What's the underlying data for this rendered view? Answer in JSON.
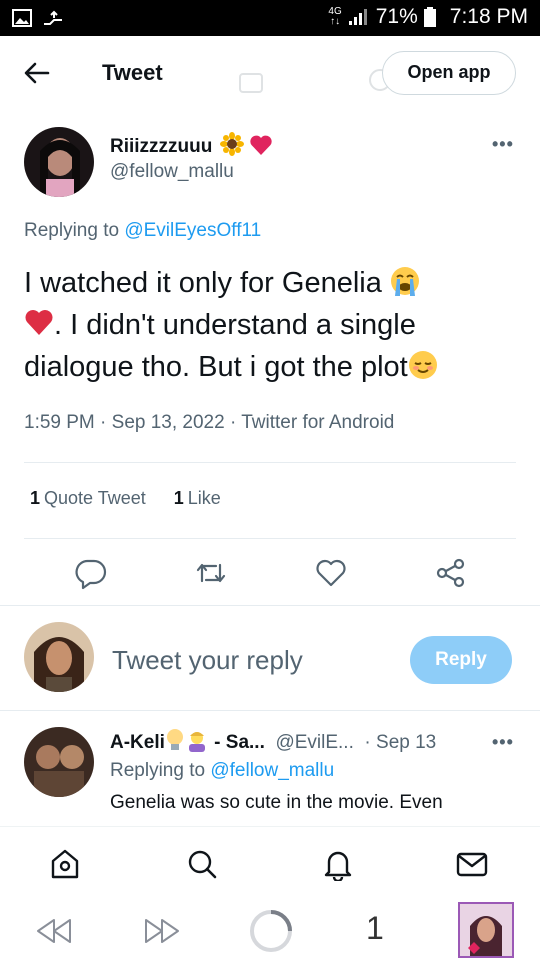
{
  "status_bar": {
    "network": "4G",
    "battery": "71%",
    "time": "7:18 PM"
  },
  "header": {
    "title": "Tweet",
    "open_app_label": "Open app"
  },
  "tweet": {
    "author_name": "Riiizzzzuuu",
    "author_handle": "@fellow_mallu",
    "replying_prefix": "Replying to ",
    "replying_to": "@EvilEyesOff11",
    "text_part1": "I watched it only for Genelia ",
    "text_part2": ". I didn't understand a single dialogue tho. But i got the plot",
    "timestamp": "1:59 PM · Sep 13, 2022 · Twitter for Android",
    "quote_count": "1",
    "quote_label": "Quote Tweet",
    "like_count": "1",
    "like_label": "Like"
  },
  "compose": {
    "placeholder": "Tweet your reply",
    "button_label": "Reply"
  },
  "reply": {
    "author_name": "A-Keli",
    "author_name_suffix": " - Sa...",
    "author_handle": "@EvilE...",
    "date": "· Sep 13",
    "replying_prefix": "Replying to ",
    "replying_to": "@fellow_mallu",
    "text": "Genelia was so cute in the movie. Even"
  },
  "browser_bar": {
    "tab_count": "1"
  },
  "colors": {
    "accent": "#1d9bf0",
    "reply_button": "#8ecdf8",
    "secondary_text": "#536471"
  }
}
